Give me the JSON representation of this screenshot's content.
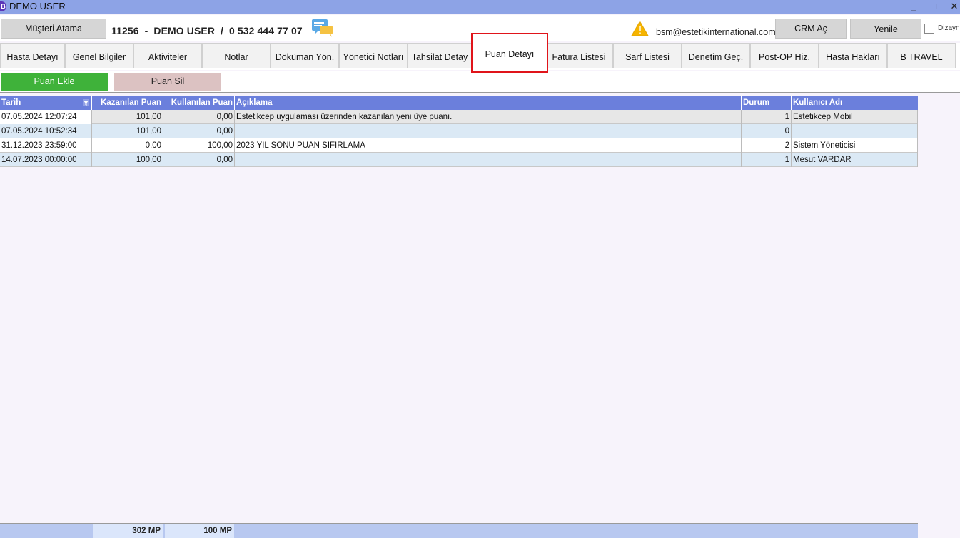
{
  "window": {
    "title": "DEMO USER",
    "minimize": "_",
    "maximize": "□",
    "close": "✕"
  },
  "header": {
    "assign_button": "Müşteri Atama",
    "patient_line": "11256  -  DEMO USER  /  0 532 444 77 07",
    "email": "bsm@estetikinternational.com",
    "crm_button": "CRM Aç",
    "refresh_button": "Yenile",
    "design_label": "Dizayn"
  },
  "tabs": [
    {
      "label": "Hasta Detayı"
    },
    {
      "label": "Genel Bilgiler"
    },
    {
      "label": "Aktiviteler"
    },
    {
      "label": "Notlar"
    },
    {
      "label": "Döküman Yön."
    },
    {
      "label": "Yönetici Notları"
    },
    {
      "label": "Tahsilat Detay"
    },
    {
      "label": "Puan Detayı",
      "active": true
    },
    {
      "label": "Fatura Listesi"
    },
    {
      "label": "Sarf Listesi"
    },
    {
      "label": "Denetim Geç."
    },
    {
      "label": "Post-OP Hiz."
    },
    {
      "label": "Hasta Hakları"
    },
    {
      "label": "B TRAVEL"
    }
  ],
  "actions": {
    "add": "Puan Ekle",
    "delete": "Puan Sil"
  },
  "table": {
    "columns": [
      "Tarih",
      "Kazanılan Puan",
      "Kullanılan Puan",
      "Açıklama",
      "Durum",
      "Kullanıcı Adı"
    ],
    "rows": [
      {
        "tarih": "07.05.2024 12:07:24",
        "kazanilan": "101,00",
        "kullanilan": "0,00",
        "aciklama": "Estetikcep uygulaması üzerinden kazanılan yeni üye puanı.",
        "durum": "1",
        "kullanici": "Estetikcep Mobil"
      },
      {
        "tarih": "07.05.2024 10:52:34",
        "kazanilan": "101,00",
        "kullanilan": "0,00",
        "aciklama": "",
        "durum": "0",
        "kullanici": ""
      },
      {
        "tarih": "31.12.2023 23:59:00",
        "kazanilan": "0,00",
        "kullanilan": "100,00",
        "aciklama": "2023 YIL SONU PUAN SIFIRLAMA",
        "durum": "2",
        "kullanici": "Sistem Yöneticisi"
      },
      {
        "tarih": "14.07.2023 00:00:00",
        "kazanilan": "100,00",
        "kullanilan": "0,00",
        "aciklama": "",
        "durum": "1",
        "kullanici": "Mesut VARDAR"
      }
    ]
  },
  "footer": {
    "total_earned": "302 MP",
    "total_used": "100 MP"
  },
  "colors": {
    "titlebar": "#8da3e6",
    "grid_header": "#6b7fdc",
    "add_button": "#3fb23a",
    "delete_button": "#dcc2c2",
    "active_tab_highlight": "#e0141a"
  },
  "icons": [
    "app-icon",
    "chat-icon",
    "warning-icon",
    "filter-icon"
  ]
}
